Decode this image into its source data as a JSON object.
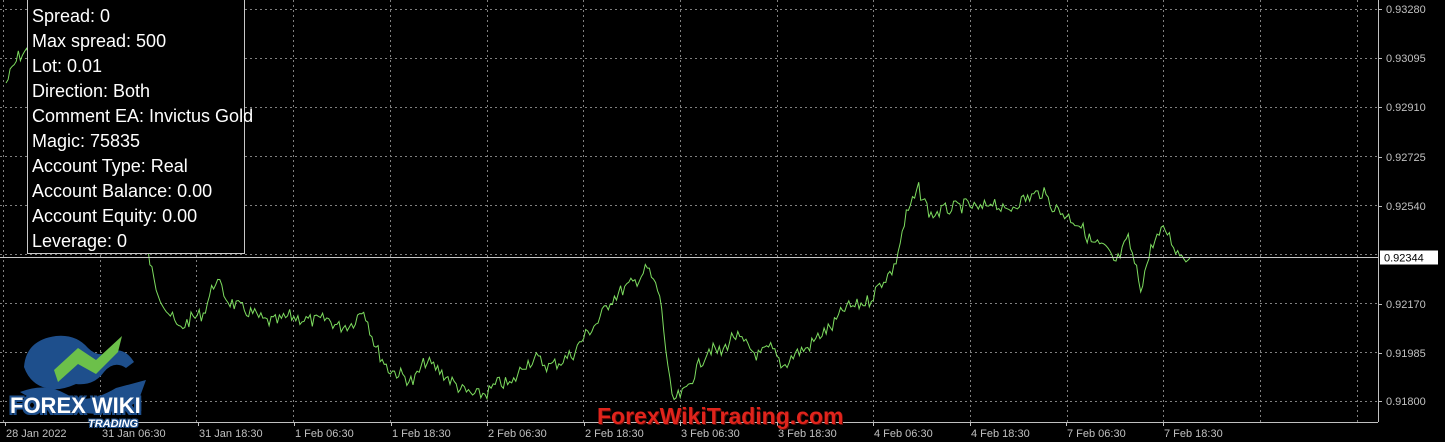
{
  "info_panel": {
    "lines": [
      "Spread: 0",
      "Max spread: 500",
      "Lot: 0.01",
      "Direction: Both",
      "Comment EA: Invictus Gold",
      "Magic: 75835",
      "Account Type: Real",
      "Account Balance: 0.00",
      "Account Equity: 0.00",
      "Leverage: 0"
    ]
  },
  "chart_data": {
    "type": "line",
    "title": "",
    "xlabel": "",
    "ylabel": "",
    "x_tick_labels": [
      "28 Jan 2022",
      "31 Jan 06:30",
      "31 Jan 18:30",
      "1 Feb 06:30",
      "1 Feb 18:30",
      "2 Feb 06:30",
      "2 Feb 18:30",
      "3 Feb 06:30",
      "3 Feb 18:30",
      "4 Feb 06:30",
      "4 Feb 18:30",
      "7 Feb 06:30",
      "7 Feb 18:30"
    ],
    "y_tick_labels": [
      "0.93280",
      "0.93095",
      "0.92910",
      "0.92725",
      "0.92540",
      "0.92170",
      "0.91985",
      "0.91800"
    ],
    "ylim": [
      0.9175,
      0.9333
    ],
    "current_price": "0.92344",
    "grid": true,
    "series": [
      {
        "values": [
          0.93,
          0.931,
          0.9313,
          0.9281,
          0.9272,
          0.9266,
          0.9274,
          0.927,
          0.9266,
          0.9262,
          0.9255,
          0.9248,
          0.9225,
          0.9215,
          0.9207,
          0.9211,
          0.9213,
          0.9226,
          0.9218,
          0.9215,
          0.9213,
          0.921,
          0.921,
          0.9212,
          0.9211,
          0.921,
          0.9211,
          0.9208,
          0.9209,
          0.9215,
          0.92,
          0.9192,
          0.919,
          0.9187,
          0.9195,
          0.9192,
          0.9188,
          0.9184,
          0.9182,
          0.9183,
          0.9187,
          0.9186,
          0.9194,
          0.9196,
          0.9193,
          0.9195,
          0.9198,
          0.9205,
          0.921,
          0.9218,
          0.9222,
          0.9225,
          0.923,
          0.922,
          0.918,
          0.9183,
          0.9192,
          0.92,
          0.9198,
          0.9205,
          0.9201,
          0.9197,
          0.92,
          0.9193,
          0.9198,
          0.92,
          0.9205,
          0.9208,
          0.9215,
          0.9216,
          0.9218,
          0.9225,
          0.923,
          0.925,
          0.926,
          0.925,
          0.9252,
          0.9253,
          0.9254,
          0.9252,
          0.9256,
          0.9251,
          0.9255,
          0.9257,
          0.9259,
          0.9253,
          0.925,
          0.9247,
          0.924,
          0.9238,
          0.9232,
          0.9241,
          0.9223,
          0.924,
          0.9245,
          0.9236,
          0.9234
        ]
      }
    ]
  },
  "watermark": "ForexWikiTrading.com",
  "logo": {
    "text": "FOREX WIKI",
    "subtext": "TRADING"
  },
  "colors": {
    "background": "#000000",
    "grid": "#808080",
    "line": "#7ddc5f",
    "axis_text": "#c0c0c0",
    "watermark": "#e0241c",
    "logo_blue": "#1e4f8c",
    "logo_green": "#6cc04a"
  }
}
